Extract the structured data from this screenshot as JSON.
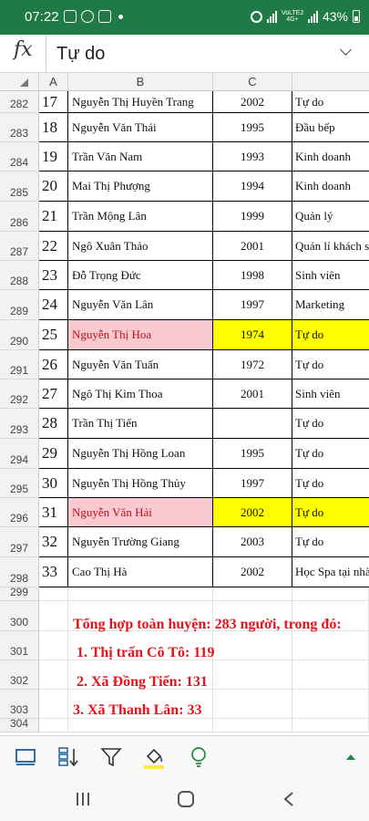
{
  "status": {
    "time": "07:22",
    "network": "VoLTE2 4G+",
    "battery": "43%"
  },
  "formula_bar": {
    "fx_label": "fx",
    "value": "Tự do"
  },
  "columns": [
    "A",
    "B",
    "C"
  ],
  "table": {
    "rows": [
      {
        "row": "282",
        "stt": "17",
        "name": "Nguyễn Thị Huyền Trang",
        "year": "2002",
        "job": "Tự do"
      },
      {
        "row": "283",
        "stt": "18",
        "name": "Nguyễn Văn Thái",
        "year": "1995",
        "job": "Đầu bếp"
      },
      {
        "row": "284",
        "stt": "19",
        "name": "Trần Văn Nam",
        "year": "1993",
        "job": "Kinh doanh"
      },
      {
        "row": "285",
        "stt": "20",
        "name": "Mai Thị Phượng",
        "year": "1994",
        "job": "Kinh doanh"
      },
      {
        "row": "286",
        "stt": "21",
        "name": "Trần Mộng Lân",
        "year": "1999",
        "job": "Quản lý"
      },
      {
        "row": "287",
        "stt": "22",
        "name": "Ngô Xuân Thảo",
        "year": "2001",
        "job": "Quản lí khách s"
      },
      {
        "row": "288",
        "stt": "23",
        "name": "Đỗ Trọng Đức",
        "year": "1998",
        "job": "Sinh viên"
      },
      {
        "row": "289",
        "stt": "24",
        "name": "Nguyễn Văn Lân",
        "year": "1997",
        "job": "Marketing"
      },
      {
        "row": "290",
        "stt": "25",
        "name": "Nguyễn Thị Hoa",
        "year": "1974",
        "job": "Tự do",
        "highlight": true
      },
      {
        "row": "291",
        "stt": "26",
        "name": "Nguyễn Văn Tuấn",
        "year": "1972",
        "job": "Tự do"
      },
      {
        "row": "292",
        "stt": "27",
        "name": "Ngô Thị Kim Thoa",
        "year": "2001",
        "job": "Sinh viên"
      },
      {
        "row": "293",
        "stt": "28",
        "name": "Trần Thị Tiến",
        "year": "",
        "job": "Tự do"
      },
      {
        "row": "294",
        "stt": "29",
        "name": "Nguyễn Thị Hồng Loan",
        "year": "1995",
        "job": "Tự do"
      },
      {
        "row": "295",
        "stt": "30",
        "name": "Nguyễn Thị Hồng Thủy",
        "year": "1997",
        "job": "Tự do"
      },
      {
        "row": "296",
        "stt": "31",
        "name": "Nguyễn Văn Hải",
        "year": "2002",
        "job": "Tự do",
        "highlight": true
      },
      {
        "row": "297",
        "stt": "32",
        "name": "Nguyễn Trường Giang",
        "year": "2003",
        "job": "Tự do"
      },
      {
        "row": "298",
        "stt": "33",
        "name": "Cao Thị Hà",
        "year": "2002",
        "job": "Học Spa tại nhà"
      }
    ]
  },
  "blank_rows": [
    "299",
    "300",
    "301",
    "302",
    "303",
    "304"
  ],
  "summary": {
    "line1": "Tổng hợp toàn huyện: 283 người, trong đó:",
    "line2": "1. Thị trấn Cô Tô: 119",
    "line3": "2. Xã Đồng Tiến: 131",
    "line4": "3. Xã Thanh Lân: 33"
  },
  "colors": {
    "status_bar": "#1f7a45",
    "highlight_name": "#f8c9cf",
    "highlight_year": "#ffff00",
    "summary_text": "#e8121b"
  },
  "toolbar_icons": [
    "screen-icon",
    "sort-icon",
    "filter-icon",
    "fill-color-icon",
    "idea-bulb-icon",
    "expand-up-icon"
  ],
  "nav_icons": [
    "recent-apps-icon",
    "home-icon",
    "back-icon"
  ]
}
